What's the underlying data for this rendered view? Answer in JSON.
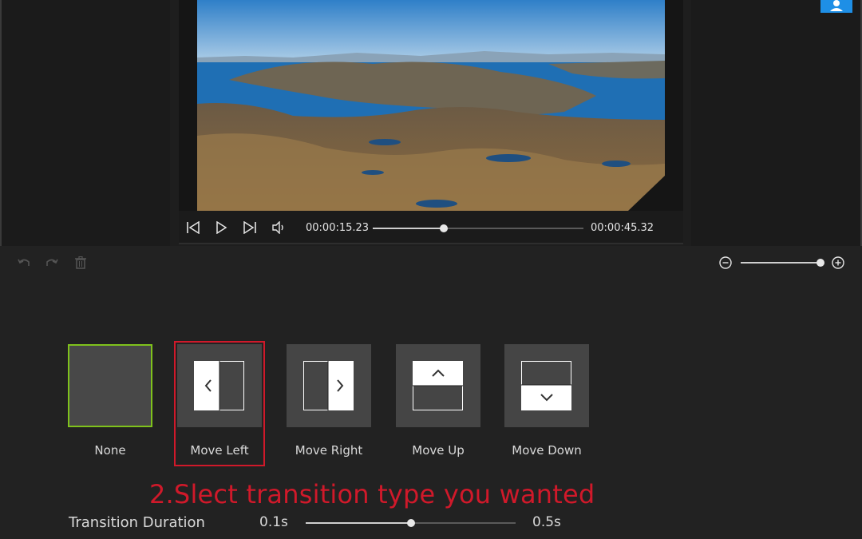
{
  "player": {
    "current_time": "00:00:15.23",
    "total_time": "00:00:45.32",
    "progress": 0.337,
    "buttons": [
      "skip-back-icon",
      "play-icon",
      "skip-forward-icon",
      "volume-icon"
    ]
  },
  "toolbar": {
    "icons": [
      "undo-icon",
      "redo-icon",
      "trash-icon"
    ],
    "zoom": {
      "out_icon": "zoom-out-icon",
      "in_icon": "zoom-in-icon",
      "level": 1.0
    }
  },
  "transitions": {
    "items": [
      {
        "label": "None",
        "icon": "none"
      },
      {
        "label": "Move Left",
        "icon": "move-left-icon"
      },
      {
        "label": "Move Right",
        "icon": "move-right-icon"
      },
      {
        "label": "Move Up",
        "icon": "move-up-icon"
      },
      {
        "label": "Move Down",
        "icon": "move-down-icon"
      }
    ],
    "selected": "None",
    "highlighted": "Move Left"
  },
  "instruction": "2.Slect transition type you wanted",
  "duration": {
    "label": "Transition Duration",
    "min_label": "0.1s",
    "max_label": "0.5s",
    "value_fraction": 0.5
  },
  "colors": {
    "accent_green": "#7fc21c",
    "annotation_red": "#d0192a",
    "user_icon_blue": "#1e8fe6"
  }
}
